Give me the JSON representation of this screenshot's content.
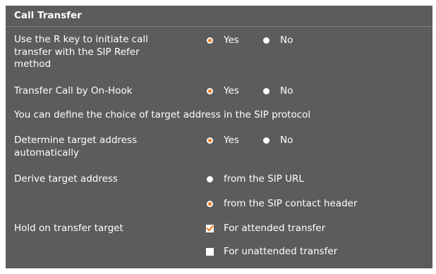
{
  "section": {
    "title": "Call Transfer"
  },
  "rows": {
    "r_key": {
      "label": "Use the R key to initiate call transfer with the SIP Refer method",
      "yes": "Yes",
      "no": "No",
      "selected": "Yes"
    },
    "on_hook": {
      "label": "Transfer Call by On-Hook",
      "yes": "Yes",
      "no": "No",
      "selected": "Yes"
    },
    "info": {
      "text": "You can define the choice of target address in the SIP protocol"
    },
    "determine": {
      "label": "Determine target address automatically",
      "yes": "Yes",
      "no": "No",
      "selected": "Yes"
    },
    "derive": {
      "label": "Derive target address",
      "opt_url": "from the SIP URL",
      "opt_contact": "from the SIP contact header",
      "selected": "from the SIP contact header"
    },
    "hold": {
      "label": "Hold on transfer target",
      "attended": "For attended transfer",
      "unattended": "For unattended transfer",
      "attended_checked": true,
      "unattended_checked": false
    }
  },
  "colors": {
    "panel_bg": "#5c5c5c",
    "accent": "#f07d1e",
    "text": "#ffffff"
  }
}
